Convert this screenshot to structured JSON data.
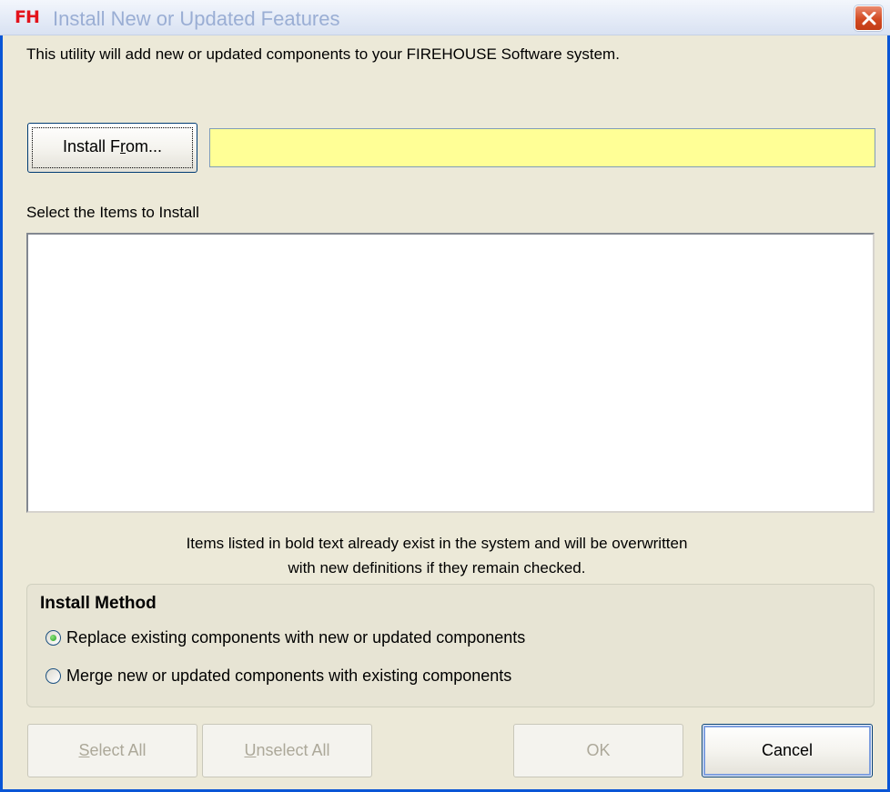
{
  "window": {
    "logo_text": "FH",
    "title": "Install New or Updated Features"
  },
  "intro_text": "This utility will add new or updated components to your FIREHOUSE Software system.",
  "install_from": {
    "label_pre": "Install F",
    "label_accel": "r",
    "label_post": "om...",
    "path_value": ""
  },
  "items": {
    "label": "Select the Items to Install",
    "entries": []
  },
  "note": {
    "line1": "Items listed in bold text already exist in the system and will be overwritten",
    "line2": "with new definitions if they remain checked."
  },
  "install_method": {
    "title": "Install Method",
    "options": [
      {
        "label": "Replace existing components with new or updated components",
        "selected": true
      },
      {
        "label": "Merge new or updated components with existing components",
        "selected": false
      }
    ]
  },
  "buttons": {
    "select_all_accel": "S",
    "select_all_rest": "elect All",
    "unselect_all_accel": "U",
    "unselect_all_rest": "nselect All",
    "ok": "OK",
    "cancel": "Cancel"
  },
  "colors": {
    "title_logo": "#e3121b",
    "path_field_bg": "#ffff96",
    "dialog_bg": "#ece9d8"
  }
}
